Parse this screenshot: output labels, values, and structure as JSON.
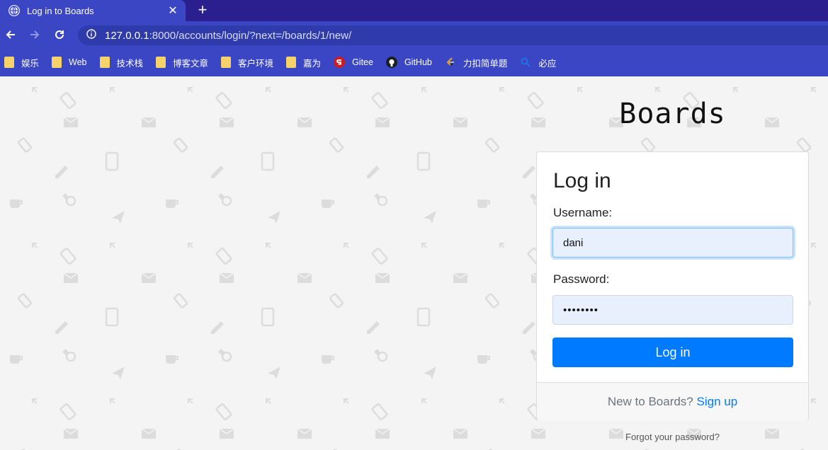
{
  "browser": {
    "tab_title": "Log in to Boards",
    "url_host": "127.0.0.1",
    "url_rest": ":8000/accounts/login/?next=/boards/1/new/",
    "bookmarks": [
      {
        "label": "娱乐",
        "icon": "folder-icon"
      },
      {
        "label": "Web",
        "icon": "folder-icon"
      },
      {
        "label": "技术栈",
        "icon": "folder-icon"
      },
      {
        "label": "博客文章",
        "icon": "folder-icon"
      },
      {
        "label": "客户环境",
        "icon": "folder-icon"
      },
      {
        "label": "嘉为",
        "icon": "folder-icon"
      },
      {
        "label": "Gitee",
        "icon": "gitee-icon"
      },
      {
        "label": "GitHub",
        "icon": "github-icon"
      },
      {
        "label": "力扣简单题",
        "icon": "leetcode-icon"
      },
      {
        "label": "必应",
        "icon": "bing-search-icon"
      }
    ]
  },
  "page": {
    "brand": "Boards",
    "heading": "Log in",
    "username_label": "Username:",
    "username_value": "dani",
    "password_label": "Password:",
    "password_value": "••••••••",
    "login_button": "Log in",
    "signup_prompt": "New to Boards?",
    "signup_link": "Sign up",
    "forgot_link": "Forgot your password?"
  },
  "colors": {
    "chrome": "#3a46c4",
    "tabbar": "#2b1f8f",
    "primary": "#007bff",
    "input_bg": "#e8f0fe"
  }
}
